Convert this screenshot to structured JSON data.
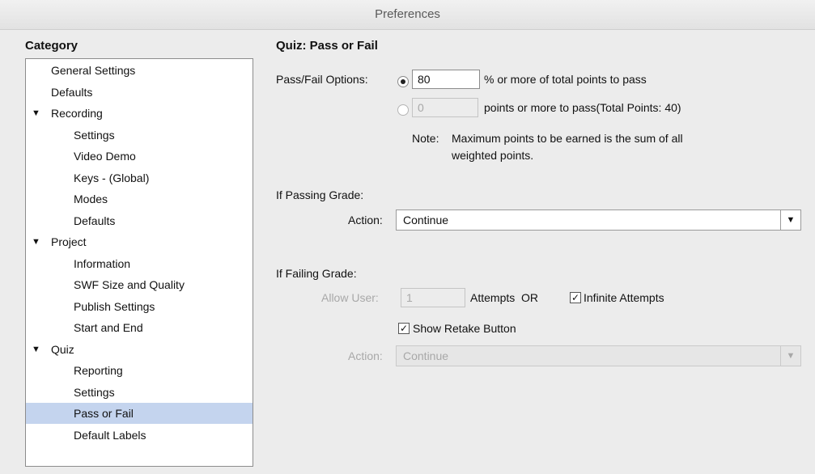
{
  "window": {
    "title": "Preferences"
  },
  "sidebar": {
    "header": "Category",
    "items": [
      {
        "label": "General Settings",
        "level": 1
      },
      {
        "label": "Defaults",
        "level": 1
      },
      {
        "label": "Recording",
        "level": 1,
        "expanded": true
      },
      {
        "label": "Settings",
        "level": 2
      },
      {
        "label": "Video Demo",
        "level": 2
      },
      {
        "label": "Keys - (Global)",
        "level": 2
      },
      {
        "label": "Modes",
        "level": 2
      },
      {
        "label": "Defaults",
        "level": 2
      },
      {
        "label": "Project",
        "level": 1,
        "expanded": true
      },
      {
        "label": "Information",
        "level": 2
      },
      {
        "label": "SWF Size and Quality",
        "level": 2
      },
      {
        "label": "Publish Settings",
        "level": 2
      },
      {
        "label": "Start and End",
        "level": 2
      },
      {
        "label": "Quiz",
        "level": 1,
        "expanded": true
      },
      {
        "label": "Reporting",
        "level": 2
      },
      {
        "label": "Settings",
        "level": 2
      },
      {
        "label": "Pass or Fail",
        "level": 2,
        "selected": true
      },
      {
        "label": "Default Labels",
        "level": 2
      }
    ],
    "expand_glyph": "▼"
  },
  "main": {
    "title": "Quiz: Pass or Fail",
    "pass_fail": {
      "label": "Pass/Fail Options:",
      "percent_value": "80",
      "percent_label": "% or more of total points to pass",
      "points_value": "0",
      "points_label": "points or more to pass(Total Points: 40)",
      "selected_option": "percent",
      "note_label": "Note:",
      "note_text_line1": "Maximum points to be earned is the sum of all",
      "note_text_line2": "weighted points."
    },
    "passing": {
      "header": "If Passing Grade:",
      "action_label": "Action:",
      "action_value": "Continue"
    },
    "failing": {
      "header": "If Failing Grade:",
      "allow_label": "Allow User:",
      "attempts_value": "1",
      "attempts_or_label": "Attempts  OR",
      "infinite_label": "Infinite Attempts",
      "infinite_checked": true,
      "retake_label": "Show Retake Button",
      "retake_checked": true,
      "action_label": "Action:",
      "action_value": "Continue"
    },
    "check_glyph": "✓",
    "dropdown_glyph": "▼"
  }
}
